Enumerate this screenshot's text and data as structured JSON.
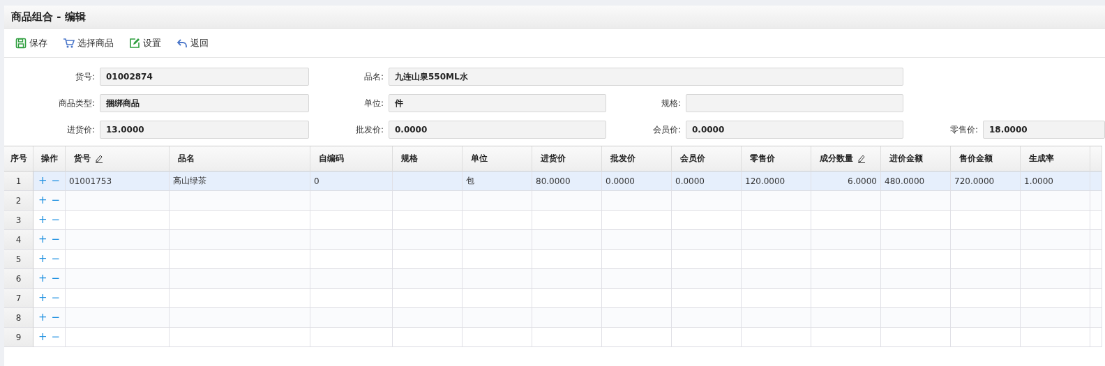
{
  "window": {
    "title": "商品组合 - 编辑"
  },
  "toolbar": [
    {
      "kind": "save",
      "label": "保存"
    },
    {
      "kind": "cart",
      "label": "选择商品"
    },
    {
      "kind": "settings",
      "label": "设置"
    },
    {
      "kind": "back",
      "label": "返回"
    }
  ],
  "form": [
    [
      {
        "label": "货号:",
        "value": "01002874"
      },
      {
        "label": "品名:",
        "value": "九连山泉550ML水",
        "wide": true
      }
    ],
    [
      {
        "label": "商品类型:",
        "value": "捆绑商品"
      },
      {
        "label": "单位:",
        "value": "件"
      },
      {
        "label": "规格:"
      }
    ],
    [
      {
        "label": "进货价:",
        "value": "13.0000"
      },
      {
        "label": "批发价:",
        "value": "0.0000"
      },
      {
        "label": "会员价:",
        "value": "0.0000"
      },
      {
        "label": "零售价:",
        "value": "18.0000"
      }
    ]
  ],
  "table": {
    "index_header": "序号",
    "actions_header": "操作",
    "columns": [
      {
        "label": "货号",
        "editable": true
      },
      {
        "label": "品名",
        "editable": false
      },
      {
        "label": "自编码",
        "editable": false
      },
      {
        "label": "规格",
        "editable": false
      },
      {
        "label": "单位",
        "editable": false
      },
      {
        "label": "进货价",
        "editable": false
      },
      {
        "label": "批发价",
        "editable": false
      },
      {
        "label": "会员价",
        "editable": false
      },
      {
        "label": "零售价",
        "editable": false
      },
      {
        "label": "成分数量",
        "editable": true
      },
      {
        "label": "进价金额",
        "editable": false
      },
      {
        "label": "售价金额",
        "editable": false
      },
      {
        "label": "生成率",
        "editable": false
      }
    ],
    "rows": [
      {
        "index": "1",
        "add": "+",
        "remove": "−",
        "selected": true,
        "cells": [
          "01001753",
          "高山绿茶",
          "0",
          "",
          "包",
          "80.0000",
          "0.0000",
          "0.0000",
          "120.0000",
          "6.0000",
          "480.0000",
          "720.0000",
          "1.0000"
        ]
      },
      {
        "index": "2",
        "add": "+",
        "remove": "−",
        "selected": false
      },
      {
        "index": "3",
        "add": "+",
        "remove": "−",
        "selected": false
      },
      {
        "index": "4",
        "add": "+",
        "remove": "−",
        "selected": false
      },
      {
        "index": "5",
        "add": "+",
        "remove": "−",
        "selected": false
      },
      {
        "index": "6",
        "add": "+",
        "remove": "−",
        "selected": false
      },
      {
        "index": "7",
        "add": "+",
        "remove": "−",
        "selected": false
      },
      {
        "index": "8",
        "add": "+",
        "remove": "−",
        "selected": false
      },
      {
        "index": "9",
        "add": "+",
        "remove": "−",
        "selected": false
      }
    ]
  }
}
